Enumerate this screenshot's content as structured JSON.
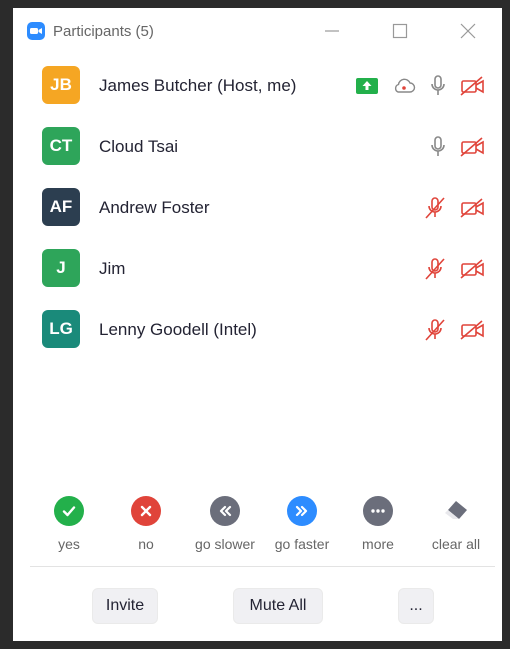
{
  "window": {
    "title": "Participants (5)"
  },
  "participants": [
    {
      "initials": "JB",
      "name": "James Butcher (Host, me)",
      "color": "#f5a623",
      "mic": "on",
      "video": "off",
      "share": true,
      "cloud": true
    },
    {
      "initials": "CT",
      "name": "Cloud Tsai",
      "color": "#2ea55a",
      "mic": "on",
      "video": "off",
      "share": false,
      "cloud": false
    },
    {
      "initials": "AF",
      "name": "Andrew Foster",
      "color": "#2c3e50",
      "mic": "muted",
      "video": "off",
      "share": false,
      "cloud": false
    },
    {
      "initials": "J",
      "name": "Jim",
      "color": "#2ea55a",
      "mic": "muted",
      "video": "off",
      "share": false,
      "cloud": false
    },
    {
      "initials": "LG",
      "name": "Lenny Goodell (Intel)",
      "color": "#1a8a7a",
      "mic": "muted",
      "video": "off",
      "share": false,
      "cloud": false
    }
  ],
  "feedback": [
    {
      "label": "yes",
      "icon": "check-icon",
      "color": "#23b04b"
    },
    {
      "label": "no",
      "icon": "x-icon",
      "color": "#e0443a"
    },
    {
      "label": "go slower",
      "icon": "rewind-icon",
      "color": "#6b6e7b"
    },
    {
      "label": "go faster",
      "icon": "fast-forward-icon",
      "color": "#2d8cff"
    },
    {
      "label": "more",
      "icon": "more-icon",
      "color": "#6b6e7b"
    },
    {
      "label": "clear all",
      "icon": "eraser-icon",
      "color": "#6b6e7b"
    }
  ],
  "bottom_bar": {
    "invite_label": "Invite",
    "mute_all_label": "Mute All",
    "more_label": "..."
  },
  "colors": {
    "accent": "#2d8cff",
    "muted_red": "#e0443a",
    "share_green": "#23b04b"
  }
}
